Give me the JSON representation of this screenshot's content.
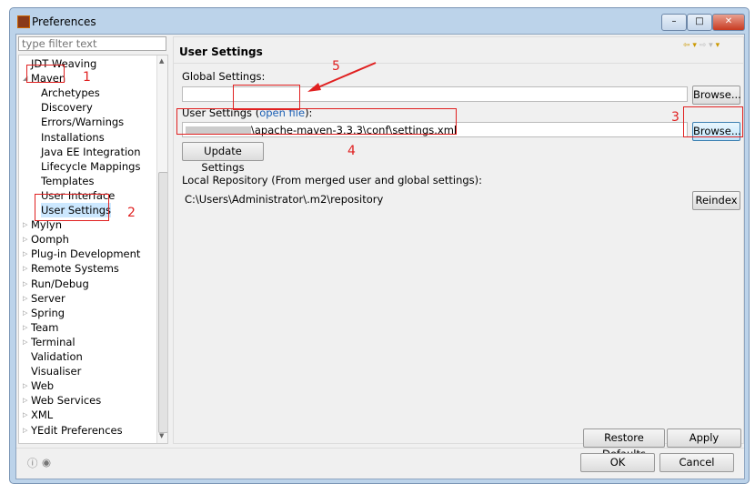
{
  "window": {
    "title": "Preferences",
    "buttons": [
      "minimize",
      "maximize",
      "close"
    ]
  },
  "filter": {
    "placeholder": "type filter text"
  },
  "tree": {
    "items": [
      {
        "label": "JDT Weaving",
        "level": 0,
        "twisty": ""
      },
      {
        "label": "Maven",
        "level": 0,
        "twisty": "expanded"
      },
      {
        "label": "Archetypes",
        "level": 1
      },
      {
        "label": "Discovery",
        "level": 1
      },
      {
        "label": "Errors/Warnings",
        "level": 1
      },
      {
        "label": "Installations",
        "level": 1
      },
      {
        "label": "Java EE Integration",
        "level": 1
      },
      {
        "label": "Lifecycle Mappings",
        "level": 1
      },
      {
        "label": "Templates",
        "level": 1
      },
      {
        "label": "User Interface",
        "level": 1
      },
      {
        "label": "User Settings",
        "level": 1,
        "selected": true
      },
      {
        "label": "Mylyn",
        "level": 0,
        "twisty": "collapsed"
      },
      {
        "label": "Oomph",
        "level": 0,
        "twisty": "collapsed"
      },
      {
        "label": "Plug-in Development",
        "level": 0,
        "twisty": "collapsed"
      },
      {
        "label": "Remote Systems",
        "level": 0,
        "twisty": "collapsed"
      },
      {
        "label": "Run/Debug",
        "level": 0,
        "twisty": "collapsed"
      },
      {
        "label": "Server",
        "level": 0,
        "twisty": "collapsed"
      },
      {
        "label": "Spring",
        "level": 0,
        "twisty": "collapsed"
      },
      {
        "label": "Team",
        "level": 0,
        "twisty": "collapsed"
      },
      {
        "label": "Terminal",
        "level": 0,
        "twisty": "collapsed"
      },
      {
        "label": "Validation",
        "level": 0,
        "twisty": ""
      },
      {
        "label": "Visualiser",
        "level": 0,
        "twisty": ""
      },
      {
        "label": "Web",
        "level": 0,
        "twisty": "collapsed"
      },
      {
        "label": "Web Services",
        "level": 0,
        "twisty": "collapsed"
      },
      {
        "label": "XML",
        "level": 0,
        "twisty": "collapsed"
      },
      {
        "label": "YEdit Preferences",
        "level": 0,
        "twisty": "collapsed"
      }
    ]
  },
  "page": {
    "title": "User Settings",
    "nav_icons": [
      "back-arrow",
      "dropdown",
      "forward-arrow",
      "dropdown",
      "menu"
    ],
    "global_label": "Global Settings:",
    "global_value": "",
    "browse": "Browse...",
    "user_label_pre": "User Settings (",
    "user_link": "open file",
    "user_label_post": "):",
    "user_value": "\\apache-maven-3.3.3\\conf\\settings.xml",
    "update": "Update Settings",
    "local_label": "Local Repository (From merged user and global settings):",
    "local_value": "C:\\Users\\Administrator\\.m2\\repository",
    "reindex": "Reindex",
    "restore": "Restore Defaults",
    "apply": "Apply"
  },
  "footer": {
    "ok": "OK",
    "cancel": "Cancel",
    "icons": [
      "help-icon",
      "import-export-icon"
    ]
  },
  "annotations": [
    "1",
    "2",
    "3",
    "4",
    "5"
  ],
  "colors": {
    "annotation": "#e02020",
    "link": "#1a5fb4",
    "selection": "#cce8ff"
  }
}
